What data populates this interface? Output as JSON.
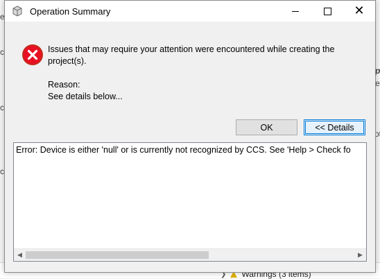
{
  "background": {
    "fragments": [
      "es",
      "ce",
      "ce",
      "ce",
      "p",
      "e",
      "ot"
    ],
    "bottom_panel": {
      "warnings_label": "Warnings (3 items)"
    }
  },
  "dialog": {
    "title": "Operation Summary",
    "window_controls": {
      "minimize": "minimize-icon",
      "maximize": "maximize-icon",
      "close": "close-icon"
    },
    "message": "Issues that may require your attention were encountered while creating the project(s).",
    "reason_label": "Reason:",
    "reason_detail": "See details below...",
    "buttons": {
      "ok": "OK",
      "details": "<< Details"
    },
    "details_text": "Error: Device is either 'null' or is currently not recognized by CCS. See 'Help > Check fo",
    "colors": {
      "error": "#e81123",
      "accent": "#0078d7"
    }
  }
}
